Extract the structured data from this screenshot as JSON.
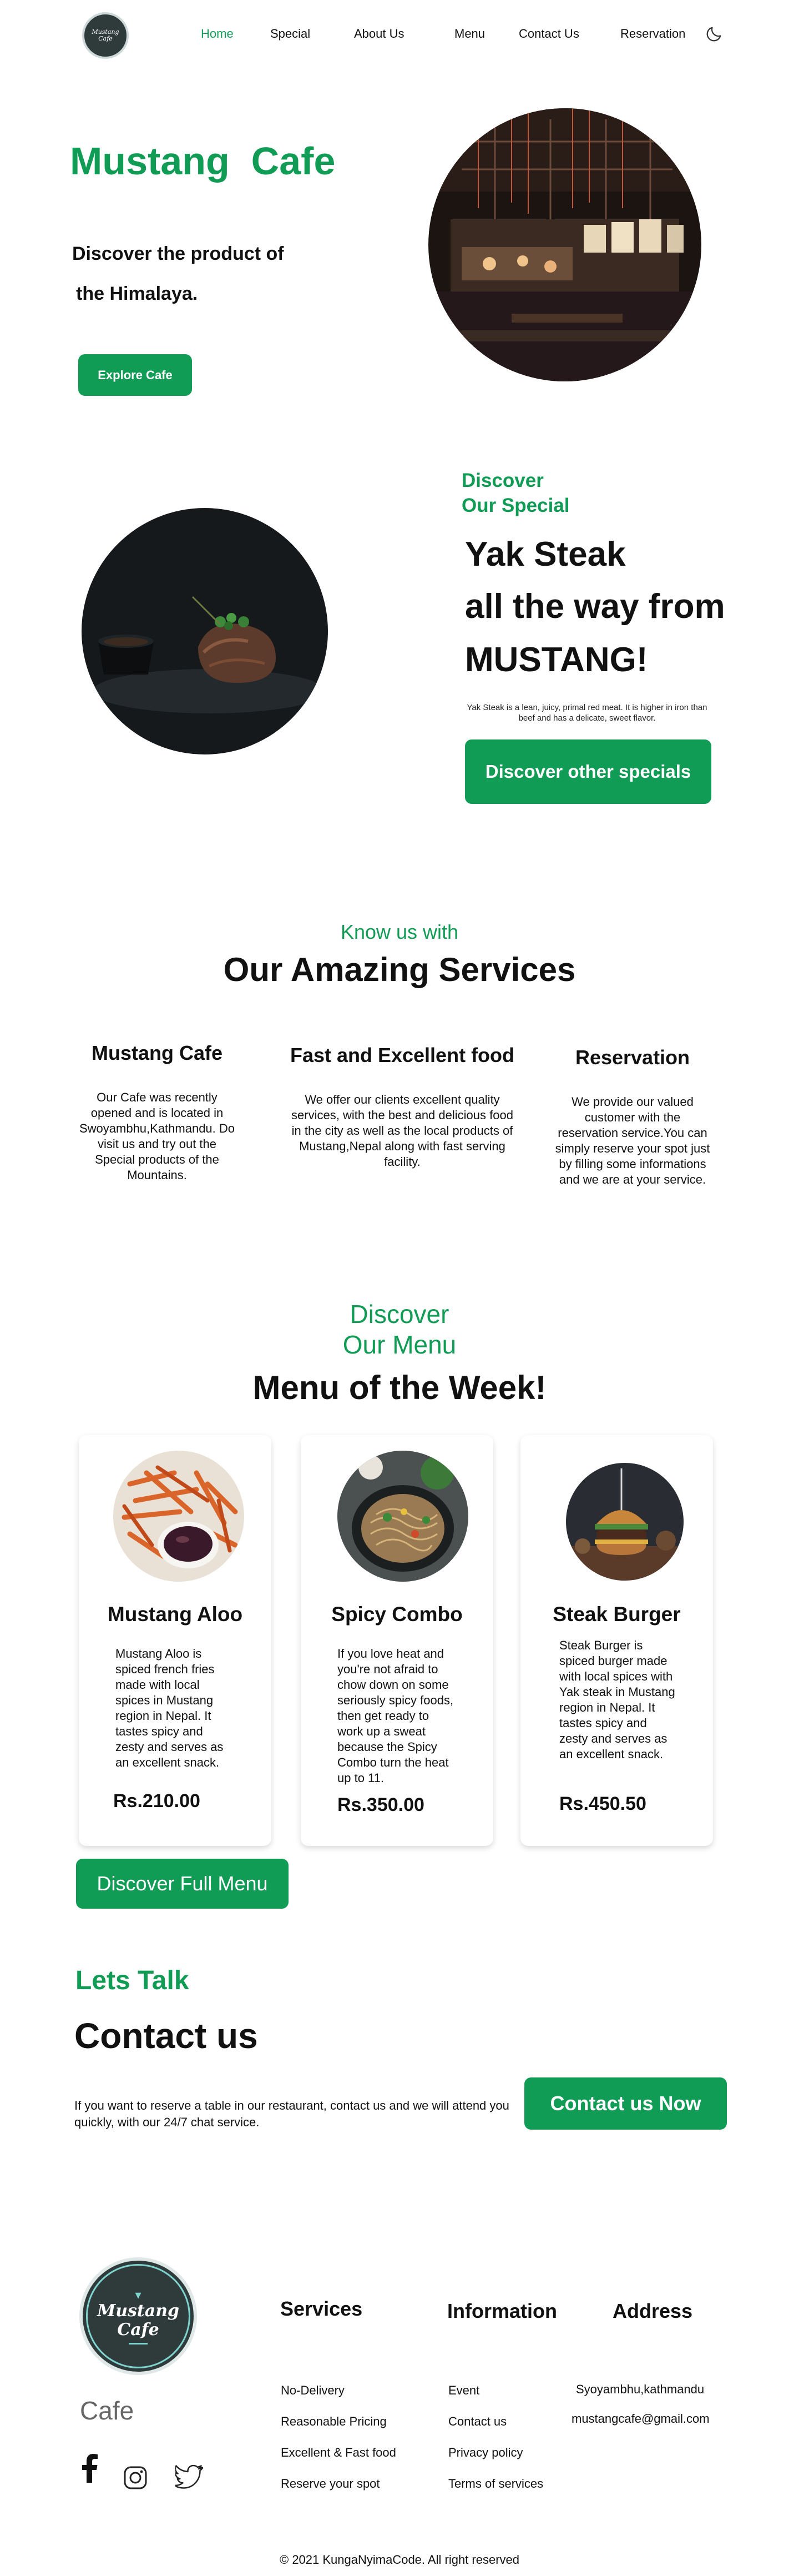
{
  "nav": {
    "logo_text_1": "Mustang",
    "logo_text_2": "Cafe",
    "links": [
      "Home",
      "Special",
      "About Us",
      "Menu",
      "Contact Us",
      "Reservation"
    ]
  },
  "hero": {
    "title": "Mustang  Cafe",
    "subtitle_line1": "Discover the product of",
    "subtitle_line2": "the Himalaya.",
    "button": "Explore Cafe"
  },
  "special": {
    "discover_line1": "Discover",
    "discover_line2": "Our Special",
    "title_line1": "Yak Steak",
    "title_line2": "all the way from",
    "title_line3": "MUSTANG!",
    "description": "Yak Steak is a lean, juicy, primal red meat. It is higher in iron than beef and has a delicate, sweet flavor.",
    "button": "Discover other specials"
  },
  "services": {
    "kicker": "Know us with",
    "title": "Our Amazing Services",
    "items": [
      {
        "title": "Mustang Cafe",
        "text": "Our Cafe was recently opened and is located in Swoyambhu,Kathmandu. Do visit us and try out the Special products of the Mountains."
      },
      {
        "title": "Fast and Excellent food",
        "text": "We offer our clients excellent quality services, with the best and delicious food in the city as well as the local products of Mustang,Nepal along with fast serving facility."
      },
      {
        "title": "Reservation",
        "text": "We provide our valued customer with the reservation service.You can simply reserve your spot just by filling some informations and we are at your service."
      }
    ]
  },
  "menu": {
    "discover_line1": "Discover",
    "discover_line2": "Our Menu",
    "title": "Menu of the Week!",
    "items": [
      {
        "name": "Mustang Aloo",
        "text": "Mustang Aloo is spiced french fries made with local spices in Mustang region in Nepal. It tastes spicy and zesty and serves as an excellent snack.",
        "price": "Rs.210.00"
      },
      {
        "name": "Spicy Combo",
        "text": "If you love heat and you're not afraid to chow down on some seriously spicy foods, then get ready to work up a sweat because the Spicy Combo turn the heat up to 11.",
        "price": "Rs.350.00"
      },
      {
        "name": "Steak Burger",
        "text": "Steak Burger is spiced burger made with local spices with Yak steak in Mustang region in Nepal. It tastes spicy and zesty and serves as an excellent snack.",
        "price": "Rs.450.50"
      }
    ],
    "button": "Discover Full Menu"
  },
  "contact": {
    "kicker": "Lets Talk",
    "title": "Contact us",
    "description": "If you want to reserve a table in our restaurant, contact us and we will attend you quickly, with our 24/7 chat service.",
    "button": "Contact us Now"
  },
  "footer": {
    "logo_text_1": "Mustang",
    "logo_text_2": "Cafe",
    "brand": "Cafe",
    "services_title": "Services",
    "services": [
      "No-Delivery",
      "Reasonable Pricing",
      "Excellent & Fast food",
      "Reserve your spot"
    ],
    "info_title": "Information",
    "info": [
      "Event",
      "Contact us",
      "Privacy policy",
      "Terms of services"
    ],
    "address_title": "Address",
    "address": [
      "Syoyambhu,kathmandu",
      "mustangcafe@gmail.com"
    ],
    "copyright": "© 2021 KungaNyimaCode. All right reserved"
  },
  "colors": {
    "accent": "#119c56",
    "dark": "#2f3b3b"
  }
}
